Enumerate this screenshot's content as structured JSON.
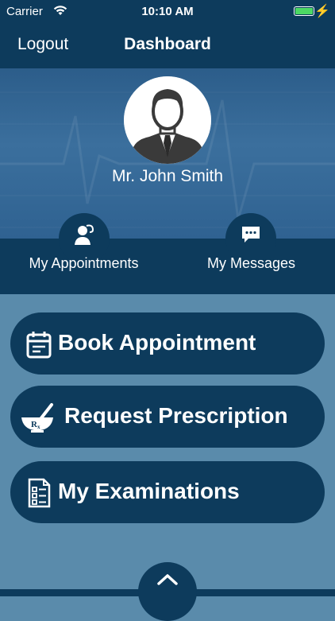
{
  "status_bar": {
    "carrier": "Carrier",
    "time": "10:10 AM"
  },
  "navbar": {
    "logout_label": "Logout",
    "title": "Dashboard"
  },
  "profile": {
    "name": "Mr. John Smith"
  },
  "tabs": [
    {
      "label": "My Appointments",
      "icon": "doctor-icon"
    },
    {
      "label": "My Messages",
      "icon": "chat-bubble-icon"
    }
  ],
  "actions": [
    {
      "label": "Book Appointment",
      "icon": "calendar-icon"
    },
    {
      "label": "Request Prescription",
      "icon": "mortar-pestle-rx-icon"
    },
    {
      "label": "My Examinations",
      "icon": "clipboard-list-icon"
    }
  ],
  "colors": {
    "primary": "#0d3b5c",
    "background": "#5a8bab",
    "hero": "#3b6f9d",
    "battery": "#4cd964"
  }
}
